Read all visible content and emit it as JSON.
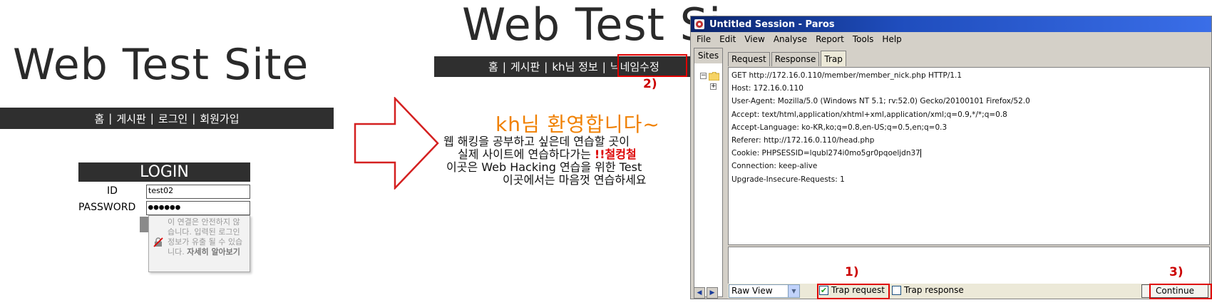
{
  "login_page": {
    "site_title": "Web Test Site",
    "nav": [
      "홈",
      "게시판",
      "로그인",
      "회원가입"
    ],
    "nav_separator": "|",
    "login_header": "LOGIN",
    "id_label": "ID",
    "password_label": "PASSWORD",
    "id_value": "test02",
    "password_value": "●●●●●●",
    "tooltip": {
      "text": "이 연결은 안전하지 않습니다. 입력된 로그인 정보가 유출 될 수 있습니다.",
      "link": "자세히 알아보기"
    }
  },
  "welcome_page": {
    "site_title": "Web Test Si",
    "nav": [
      "홈",
      "게시판",
      "kh님 정보",
      "닉네임수정"
    ],
    "nav_separator": "|",
    "heading": "kh님 환영합니다~",
    "lines": {
      "l1": "웹 해킹을 공부하고 싶은데 연습할 곳이",
      "l2_pre": "실제 사이트에 연습하다가는 ",
      "l2_red": "!!철컹철",
      "l3": "이곳은 Web Hacking 연습을 위한 Test",
      "l4": "이곳에서는 마음껏 연습하세요"
    }
  },
  "annotations": {
    "step1": "1)",
    "step2": "2)",
    "step3": "3)",
    "highlight_color": "#e00000"
  },
  "paros": {
    "title": "Untitled Session - Paros",
    "menu": [
      "File",
      "Edit",
      "View",
      "Analyse",
      "Report",
      "Tools",
      "Help"
    ],
    "sites_tab": "Sites",
    "tabs": [
      "Request",
      "Response",
      "Trap"
    ],
    "active_tab": "Trap",
    "request_lines": [
      "GET http://172.16.0.110/member/member_nick.php HTTP/1.1",
      "Host: 172.16.0.110",
      "User-Agent: Mozilla/5.0 (Windows NT 5.1; rv:52.0) Gecko/20100101 Firefox/52.0",
      "Accept: text/html,application/xhtml+xml,application/xml;q=0.9,*/*;q=0.8",
      "Accept-Language: ko-KR,ko;q=0.8,en-US;q=0.5,en;q=0.3",
      "Referer: http://172.16.0.110/head.php",
      "Cookie: PHPSESSID=lqubl274i0mo5gr0pqoeljdn37",
      "Connection: keep-alive",
      "Upgrade-Insecure-Requests: 1"
    ],
    "view_select": "Raw View",
    "trap_request_label": "Trap request",
    "trap_request_checked": true,
    "trap_response_label": "Trap response",
    "trap_response_checked": false,
    "continue_label": "Continue",
    "title_bar_color": "#0a246a",
    "chrome_color": "#d4d0c8"
  }
}
